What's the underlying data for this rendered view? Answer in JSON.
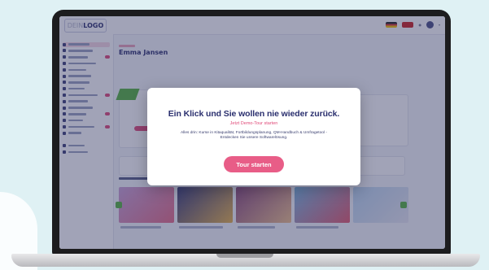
{
  "app": {
    "logo_prefix": "DEIN",
    "logo_main": "LOGO"
  },
  "header": {
    "user_name": "Emma Jansen"
  },
  "modal": {
    "title": "Ein Klick und Sie wollen nie wieder zurück.",
    "subtitle": "Jetzt Demo-Tour starten",
    "description": "Alles drin: Kurse in Kitaqualität, Fortbildungsplanung, QM-Handbuch & Umfragetool - Entdecken Sie unsere Softwarelösung.",
    "button_label": "Tour starten"
  },
  "colors": {
    "accent": "#e85d87",
    "brand": "#2a2f6e",
    "success": "#57b33e",
    "overlay": "#2e3460"
  },
  "icons": {
    "avatar": "user-avatar-icon",
    "flags": [
      "flag-de-icon",
      "flag-gb-icon"
    ]
  }
}
